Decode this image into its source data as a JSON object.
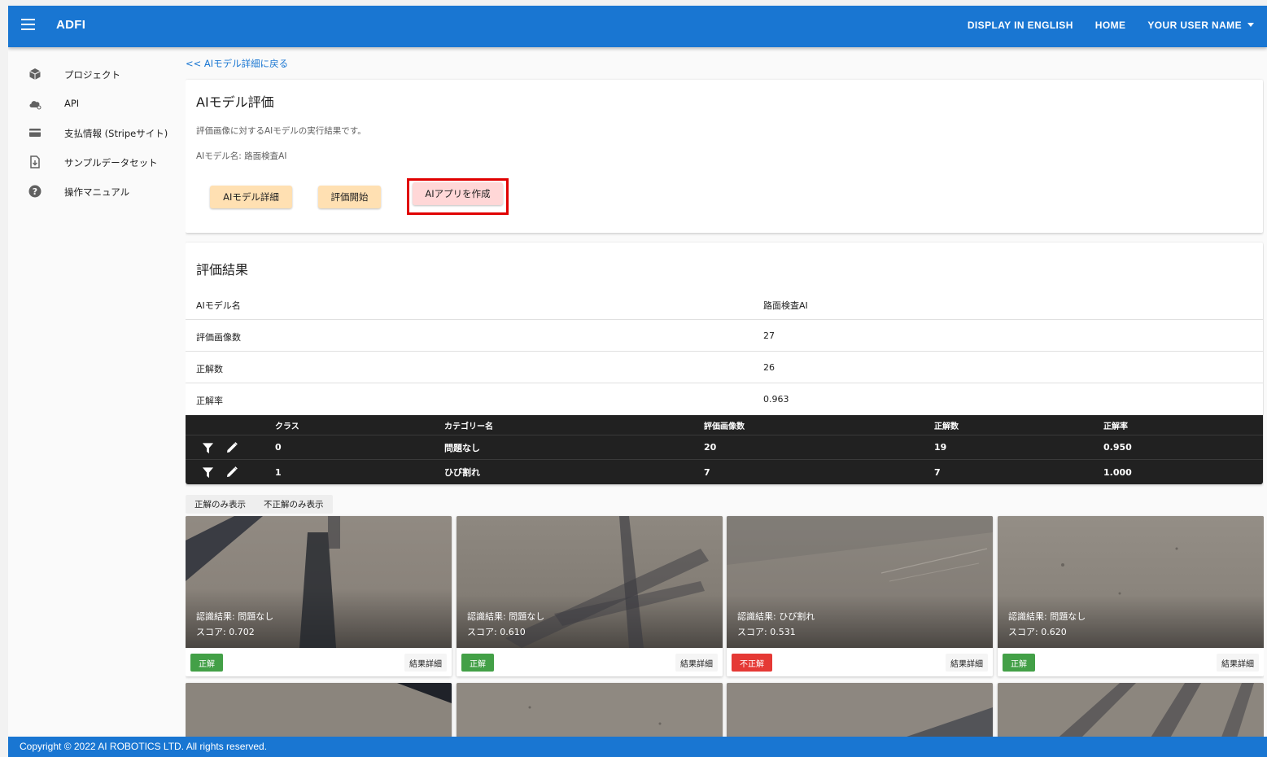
{
  "app": {
    "brand": "ADFI"
  },
  "topnav": {
    "english": "DISPLAY IN ENGLISH",
    "home": "HOME",
    "user": "YOUR USER NAME"
  },
  "sidebar": {
    "items": [
      {
        "label": "プロジェクト",
        "icon": "cube-icon"
      },
      {
        "label": "API",
        "icon": "cloud-icon"
      },
      {
        "label": "支払情報 (Stripeサイト)",
        "icon": "credit-card-icon"
      },
      {
        "label": "サンプルデータセット",
        "icon": "file-download-icon"
      },
      {
        "label": "操作マニュアル",
        "icon": "help-icon"
      }
    ]
  },
  "main": {
    "back_link": "<< AIモデル詳細に戻る",
    "eval_card": {
      "title": "AIモデル評価",
      "description": "評価画像に対するAIモデルの実行結果です。",
      "model_name_line": "AIモデル名: 路面検査AI",
      "buttons": {
        "detail": "AIモデル詳細",
        "start": "評価開始",
        "create_app": "AIアプリを作成"
      }
    },
    "results": {
      "title": "評価結果",
      "rows": [
        {
          "label": "AIモデル名",
          "value": "路面検査AI"
        },
        {
          "label": "評価画像数",
          "value": "27"
        },
        {
          "label": "正解数",
          "value": "26"
        },
        {
          "label": "正解率",
          "value": "0.963"
        }
      ],
      "table": {
        "headers": {
          "cls": "クラス",
          "category": "カテゴリー名",
          "images": "評価画像数",
          "correct": "正解数",
          "rate": "正解率"
        },
        "rows": [
          {
            "cls": "0",
            "category": "問題なし",
            "images": "20",
            "correct": "19",
            "rate": "0.950"
          },
          {
            "cls": "1",
            "category": "ひび割れ",
            "images": "7",
            "correct": "7",
            "rate": "1.000"
          }
        ]
      }
    },
    "filters": {
      "correct_only": "正解のみ表示",
      "incorrect_only": "不正解のみ表示"
    },
    "tiles": [
      {
        "result": "認識結果: 問題なし",
        "score": "スコア: 0.702",
        "badge": "正解",
        "badge_color": "#43a047",
        "detail": "結果詳細"
      },
      {
        "result": "認識結果: 問題なし",
        "score": "スコア: 0.610",
        "badge": "正解",
        "badge_color": "#43a047",
        "detail": "結果詳細"
      },
      {
        "result": "認識結果: ひび割れ",
        "score": "スコア: 0.531",
        "badge": "不正解",
        "badge_color": "#e53935",
        "detail": "結果詳細"
      },
      {
        "result": "認識結果: 問題なし",
        "score": "スコア: 0.620",
        "badge": "正解",
        "badge_color": "#43a047",
        "detail": "結果詳細"
      }
    ]
  },
  "footer": {
    "copyright": "Copyright © 2022 AI ROBOTICS LTD. All rights reserved."
  },
  "colors": {
    "primary": "#1976d2",
    "button_bg": "#ffe0b2",
    "highlight": "#e00000",
    "correct": "#43a047",
    "incorrect": "#e53935"
  }
}
